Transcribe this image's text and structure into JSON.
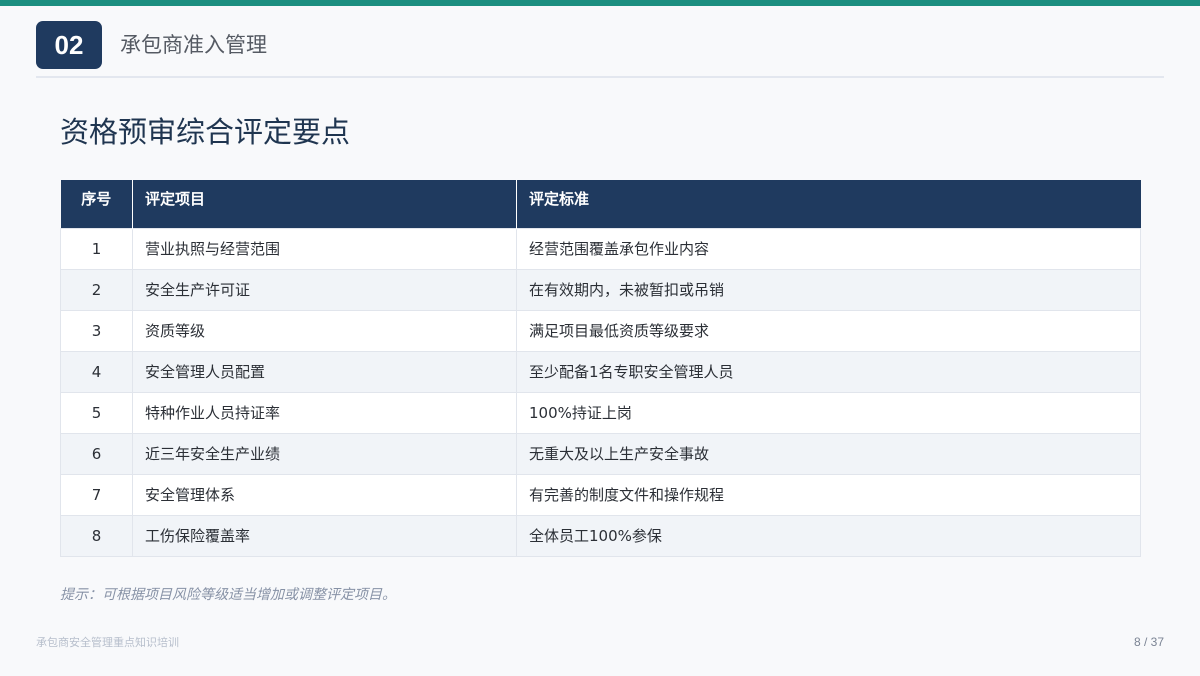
{
  "accent_colors": {
    "top_bar": "#1c8f80",
    "navy": "#1f3a5f",
    "title_text": "#1f3550"
  },
  "header": {
    "section_number": "02",
    "section_title": "承包商准入管理"
  },
  "page_title": "资格预审综合评定要点",
  "table": {
    "headers": {
      "index": "序号",
      "item": "评定项目",
      "standard": "评定标准"
    },
    "rows": [
      {
        "index": "1",
        "item": "营业执照与经营范围",
        "standard": "经营范围覆盖承包作业内容"
      },
      {
        "index": "2",
        "item": "安全生产许可证",
        "standard": "在有效期内，未被暂扣或吊销"
      },
      {
        "index": "3",
        "item": "资质等级",
        "standard": "满足项目最低资质等级要求"
      },
      {
        "index": "4",
        "item": "安全管理人员配置",
        "standard": "至少配备1名专职安全管理人员"
      },
      {
        "index": "5",
        "item": "特种作业人员持证率",
        "standard": "100%持证上岗"
      },
      {
        "index": "6",
        "item": "近三年安全生产业绩",
        "standard": "无重大及以上生产安全事故"
      },
      {
        "index": "7",
        "item": "安全管理体系",
        "standard": "有完善的制度文件和操作规程"
      },
      {
        "index": "8",
        "item": "工伤保险覆盖率",
        "standard": "全体员工100%参保"
      }
    ]
  },
  "tip": "提示：可根据项目风险等级适当增加或调整评定项目。",
  "footer": {
    "title": "承包商安全管理重点知识培训",
    "page_number": "8 / 37"
  }
}
